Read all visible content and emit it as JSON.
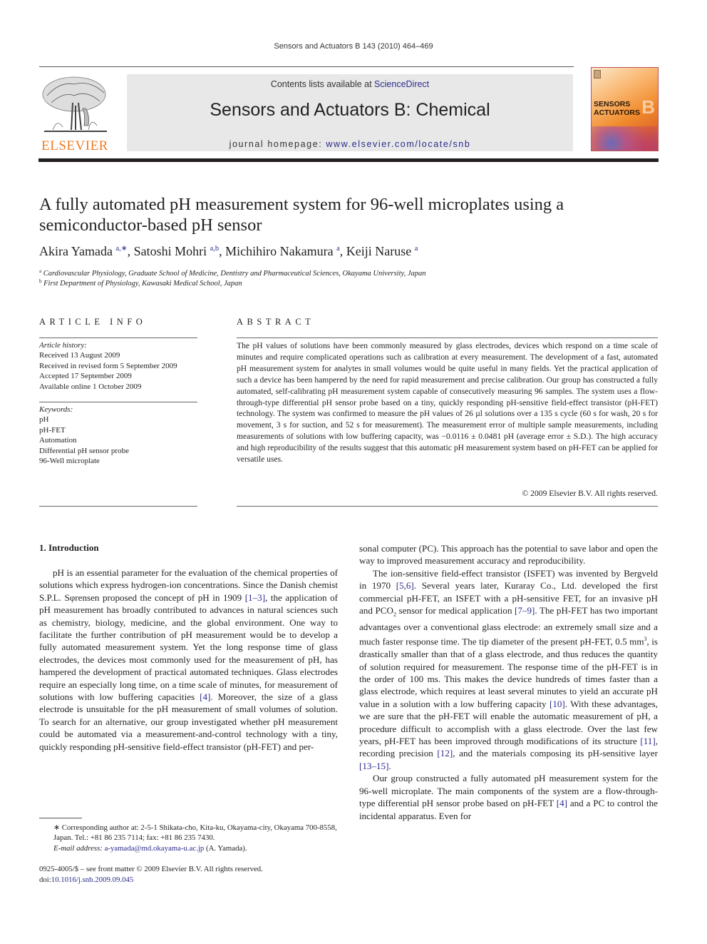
{
  "header": {
    "citation": "Sensors and Actuators B 143 (2010) 464–469",
    "contents_prefix": "Contents lists available at ",
    "contents_link": "ScienceDirect",
    "journal_name": "Sensors and Actuators B: Chemical",
    "homepage_prefix": "journal homepage: ",
    "homepage_url": "www.elsevier.com/locate/snb",
    "publisher_logo_text": "ELSEVIER",
    "cover_title_line1": "SENSORS",
    "cover_title_line2": "ACTUATORS",
    "cover_letter": "B"
  },
  "colors": {
    "link": "#2a2a8c",
    "publisher_orange": "#f07b22",
    "banner_gray": "#e8e8e8"
  },
  "article": {
    "title": "A fully automated pH measurement system for 96-well microplates using a semiconductor-based pH sensor",
    "authors": [
      {
        "name": "Akira Yamada",
        "affil": "a,∗"
      },
      {
        "name": "Satoshi Mohri",
        "affil": "a,b"
      },
      {
        "name": "Michihiro Nakamura",
        "affil": "a"
      },
      {
        "name": "Keiji Naruse",
        "affil": "a"
      }
    ],
    "affiliations": [
      {
        "key": "a",
        "text": "Cardiovascular Physiology, Graduate School of Medicine, Dentistry and Pharmaceutical Sciences, Okayama University, Japan"
      },
      {
        "key": "b",
        "text": "First Department of Physiology, Kawasaki Medical School, Japan"
      }
    ]
  },
  "article_info": {
    "heading": "ARTICLE INFO",
    "history_label": "Article history:",
    "history": [
      "Received 13 August 2009",
      "Received in revised form 5 September 2009",
      "Accepted 17 September 2009",
      "Available online 1 October 2009"
    ],
    "keywords_label": "Keywords:",
    "keywords": [
      "pH",
      "pH-FET",
      "Automation",
      "Differential pH sensor probe",
      "96-Well microplate"
    ]
  },
  "abstract": {
    "heading": "ABSTRACT",
    "text": "The pH values of solutions have been commonly measured by glass electrodes, devices which respond on a time scale of minutes and require complicated operations such as calibration at every measurement. The development of a fast, automated pH measurement system for analytes in small volumes would be quite useful in many fields. Yet the practical application of such a device has been hampered by the need for rapid measurement and precise calibration. Our group has constructed a fully automated, self-calibrating pH measurement system capable of consecutively measuring 96 samples. The system uses a flow-through-type differential pH sensor probe based on a tiny, quickly responding pH-sensitive field-effect transistor (pH-FET) technology. The system was confirmed to measure the pH values of 26 µl solutions over a 135 s cycle (60 s for wash, 20 s for movement, 3 s for suction, and 52 s for measurement). The measurement error of multiple sample measurements, including measurements of solutions with low buffering capacity, was −0.0116 ± 0.0481 pH (average error ± S.D.). The high accuracy and high reproducibility of the results suggest that this automatic pH measurement system based on pH-FET can be applied for versatile uses.",
    "copyright": "© 2009 Elsevier B.V. All rights reserved."
  },
  "body": {
    "section_heading": "1.  Introduction",
    "left_p1": [
      {
        "t": "pH is an essential parameter for the evaluation of the chemical properties of solutions which express hydrogen-ion concentrations. Since the Danish chemist S.P.L. Sφrensen proposed the concept of pH in 1909 "
      },
      {
        "ref": "[1–3]"
      },
      {
        "t": ", the application of pH measurement has broadly contributed to advances in natural sciences such as chemistry, biology, medicine, and the global environment. One way to facilitate the further contribution of pH measurement would be to develop a fully automated measurement system. Yet the long response time of glass electrodes, the devices most commonly used for the measurement of pH, has hampered the development of practical automated techniques. Glass electrodes require an especially long time, on a time scale of minutes, for measurement of solutions with low buffering capacities "
      },
      {
        "ref": "[4]"
      },
      {
        "t": ". Moreover, the size of a glass electrode is unsuitable for the pH measurement of small volumes of solution. To search for an alternative, our group investigated whether pH measurement could be automated via a measurement-and-control technology with a tiny, quickly responding pH-sensitive field-effect transistor (pH-FET) and per-"
      }
    ],
    "right_p0": "sonal computer (PC). This approach has the potential to save labor and open the way to improved measurement accuracy and reproducibility.",
    "right_p1": [
      {
        "t": "The ion-sensitive field-effect transistor (ISFET) was invented by Bergveld in 1970 "
      },
      {
        "ref": "[5,6]"
      },
      {
        "t": ". Several years later, Kuraray Co., Ltd. developed the first commercial pH-FET, an ISFET with a pH-sensitive FET, for an invasive pH and PCO"
      },
      {
        "sub": "2"
      },
      {
        "t": " sensor for medical application "
      },
      {
        "ref": "[7–9]"
      },
      {
        "t": ". The pH-FET has two important advantages over a conventional glass electrode: an extremely small size and a much faster response time. The tip diameter of the present pH-FET, 0.5 mm"
      },
      {
        "sup": "3"
      },
      {
        "t": ", is drastically smaller than that of a glass electrode, and thus reduces the quantity of solution required for measurement. The response time of the pH-FET is in the order of 100 ms. This makes the device hundreds of times faster than a glass electrode, which requires at least several minutes to yield an accurate pH value in a solution with a low buffering capacity "
      },
      {
        "ref": "[10]"
      },
      {
        "t": ". With these advantages, we are sure that the pH-FET will enable the automatic measurement of pH, a procedure difficult to accomplish with a glass electrode. Over the last few years, pH-FET has been improved through modifications of its structure "
      },
      {
        "ref": "[11]"
      },
      {
        "t": ", recording precision "
      },
      {
        "ref": "[12]"
      },
      {
        "t": ", and the materials composing its pH-sensitive layer "
      },
      {
        "ref": "[13–15]"
      },
      {
        "t": "."
      }
    ],
    "right_p2": [
      {
        "t": "Our group constructed a fully automated pH measurement system for the 96-well microplate. The main components of the system are a flow-through-type differential pH sensor probe based on pH-FET "
      },
      {
        "ref": "[4]"
      },
      {
        "t": " and a PC to control the incidental apparatus. Even for"
      }
    ]
  },
  "footnote": {
    "corresponding": "∗  Corresponding author at: 2-5-1 Shikata-cho, Kita-ku, Okayama-city, Okayama 700-8558, Japan. Tel.: +81 86 235 7114; fax: +81 86 235 7430.",
    "email_label": "E-mail address: ",
    "email": "a-yamada@md.okayama-u.ac.jp",
    "email_suffix": " (A. Yamada).",
    "issn_line": "0925-4005/$ – see front matter © 2009 Elsevier B.V. All rights reserved.",
    "doi_label": "doi:",
    "doi": "10.1016/j.snb.2009.09.045"
  }
}
